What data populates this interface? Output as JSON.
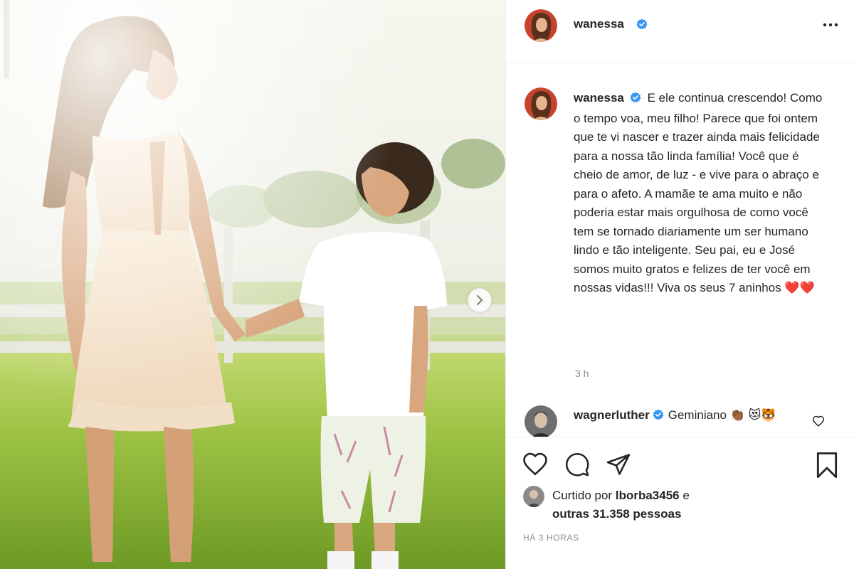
{
  "post": {
    "author": "wanessa",
    "caption_author": "wanessa",
    "caption_text": "E ele continua crescendo! Como o tempo voa, meu filho! Parece que foi ontem que te vi nascer e trazer ainda mais felicidade para a nossa tão linda família! Você que é cheio de amor, de luz - e vive para o abraço e para o afeto. A mamãe te ama muito e não poderia estar mais orgulhosa de como você tem se tornado diariamente um ser humano lindo e tão inteligente. Seu pai, eu e José somos muito gratos e felizes de ter você em nossas vidas!!! Viva os seus 7 aninhos ❤️❤️",
    "caption_time": "3 h"
  },
  "comment": {
    "author": "wagnerluther",
    "text": "Geminiano 👏🏾 😻🐯"
  },
  "likes": {
    "prefix": "Curtido por",
    "user": "lborba3456",
    "conjunction": "e",
    "others": "outras 31.358 pessoas"
  },
  "timestamp": "HÁ 3 HORAS",
  "icons": {
    "verified": "verified-badge-icon",
    "more": "more-options-icon",
    "like": "heart-icon",
    "comment": "comment-icon",
    "share": "share-icon",
    "save": "bookmark-icon",
    "next": "chevron-right-icon"
  },
  "colors": {
    "verified_blue": "#3897f0",
    "text": "#262626",
    "secondary": "#8e8e8e",
    "border": "#efefef"
  }
}
